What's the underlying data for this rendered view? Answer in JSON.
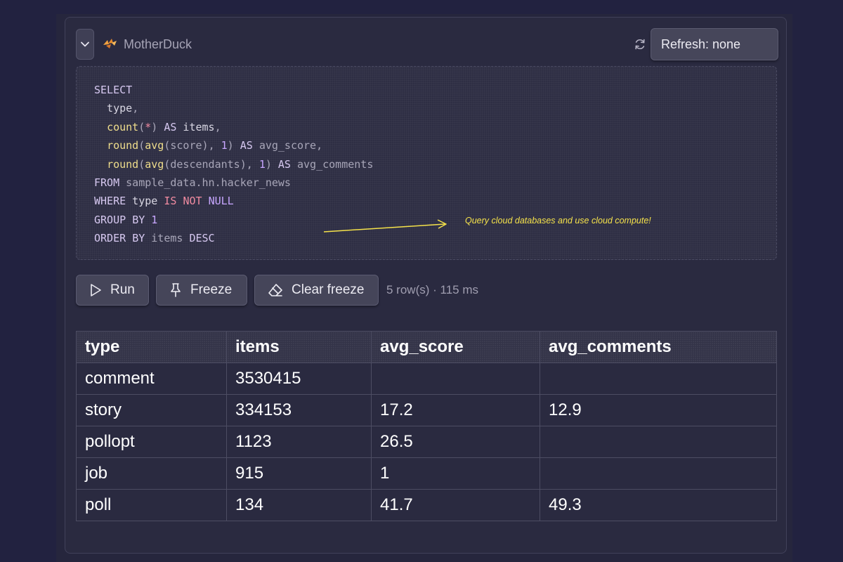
{
  "header": {
    "database_name": "MotherDuck",
    "logo_icon": "motherduck-logo-icon",
    "collapse_icon": "chevron-down-icon",
    "sync_icon": "refresh-icon",
    "refresh_label": "Refresh: none"
  },
  "editor": {
    "language": "sql",
    "lines": [
      "SELECT",
      "  type,",
      "  count(*) AS items,",
      "  round(avg(score), 1) AS avg_score,",
      "  round(avg(descendants), 1) AS avg_comments",
      "FROM sample_data.hn.hacker_news",
      "WHERE type IS NOT NULL",
      "GROUP BY 1",
      "ORDER BY items DESC"
    ],
    "annotation": "Query cloud databases and use cloud compute!"
  },
  "toolbar": {
    "run_label": "Run",
    "freeze_label": "Freeze",
    "clear_freeze_label": "Clear freeze",
    "status": "5 row(s) · 115 ms",
    "icons": [
      "play-icon",
      "pin-icon",
      "eraser-icon"
    ]
  },
  "results": {
    "columns": [
      "type",
      "items",
      "avg_score",
      "avg_comments"
    ],
    "rows": [
      [
        "comment",
        "3530415",
        "",
        ""
      ],
      [
        "story",
        "334153",
        "17.2",
        "12.9"
      ],
      [
        "pollopt",
        "1123",
        "26.5",
        ""
      ],
      [
        "job",
        "915",
        "1",
        ""
      ],
      [
        "poll",
        "134",
        "41.7",
        "49.3"
      ]
    ]
  },
  "colors": {
    "page_background": "#222240",
    "panel_background": "#2a2a40",
    "annotation": "#f5e24a",
    "keyword": "#d6c8f0",
    "function": "#f0de8c",
    "operator": "#f08aa0",
    "number": "#c7a6ff",
    "logo": "#f0a040"
  }
}
